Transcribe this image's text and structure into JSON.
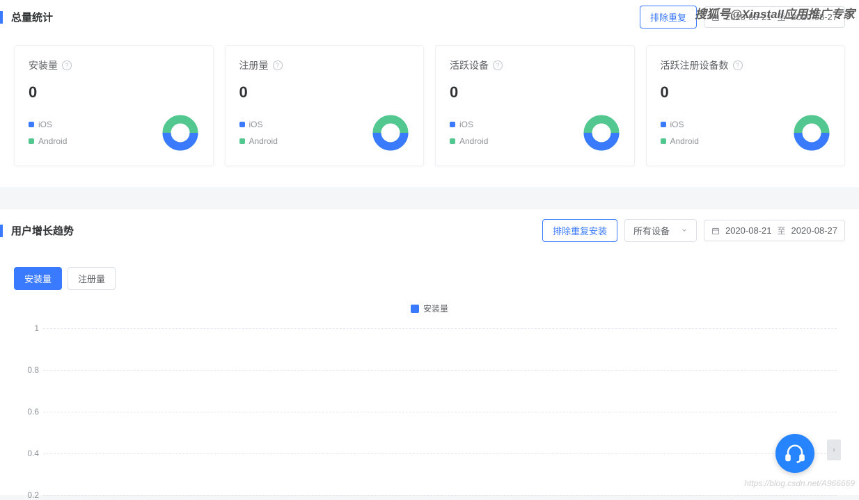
{
  "section1": {
    "title": "总量统计",
    "exclude_btn": "排除重复",
    "date_from": "2020-08-21",
    "date_to": "2020-08-27",
    "date_sep": "至"
  },
  "cards": [
    {
      "title": "安装量",
      "value": "0",
      "legend_ios": "iOS",
      "legend_android": "Android"
    },
    {
      "title": "注册量",
      "value": "0",
      "legend_ios": "iOS",
      "legend_android": "Android"
    },
    {
      "title": "活跃设备",
      "value": "0",
      "legend_ios": "iOS",
      "legend_android": "Android"
    },
    {
      "title": "活跃注册设备数",
      "value": "0",
      "legend_ios": "iOS",
      "legend_android": "Android"
    }
  ],
  "section2": {
    "title": "用户增长趋势",
    "exclude_btn": "排除重复安装",
    "device_select": "所有设备",
    "date_from": "2020-08-21",
    "date_to": "2020-08-27",
    "date_sep": "至"
  },
  "tabs": {
    "install": "安装量",
    "register": "注册量"
  },
  "chart_legend": "安装量",
  "chart_data": {
    "type": "line",
    "title": "",
    "xlabel": "",
    "ylabel": "",
    "ylim": [
      0,
      1
    ],
    "yticks": [
      1,
      0.8,
      0.6,
      0.4,
      0.2
    ],
    "categories": [],
    "series": [
      {
        "name": "安装量",
        "values": []
      }
    ]
  },
  "watermark_top": "搜狐号@Xinstall应用推广专家",
  "watermark_bottom": "https://blog.csdn.net/A966669"
}
